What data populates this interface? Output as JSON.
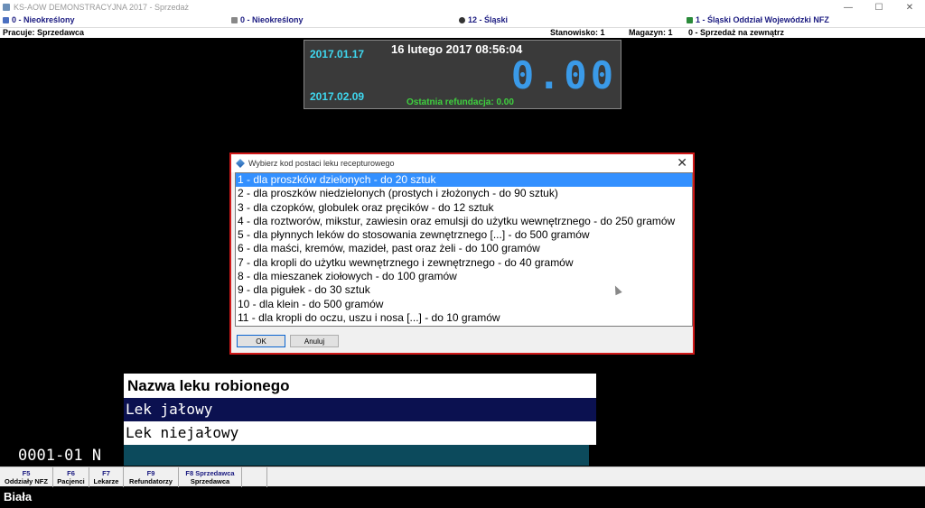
{
  "window": {
    "title": "KS-AOW DEMONSTRACYJNA 2017 - Sprzedaż",
    "minimize": "—",
    "maximize": "☐",
    "close": "✕"
  },
  "info_row1": {
    "c1": "0 - Nieokreślony",
    "c2": "0 - Nieokreślony",
    "c3": "12 - Śląski",
    "c4": "1 - Śląski Oddział Wojewódzki NFZ"
  },
  "info_row2": {
    "pracuje": "Pracuje: Sprzedawca",
    "stanowisko": "Stanowisko: 1",
    "magazyn": "Magazyn: 1",
    "sprzedaz": "0 - Sprzedaż na zewnątrz"
  },
  "display": {
    "date1": "2017.01.17",
    "date2": "2017.02.09",
    "datetime": "16 lutego 2017  08:56:04",
    "amount": "0.00",
    "refund": "Ostatnia refundacja: 0.00"
  },
  "dialog": {
    "title": "Wybierz kod postaci leku recepturowego",
    "close": "✕",
    "items": [
      "1 - dla proszków dzielonych - do 20 sztuk",
      "2 - dla proszków niedzielonych (prostych i złożonych - do 90 sztuk)",
      "3 - dla czopków, globulek oraz pręcików - do 12 sztuk",
      "4 - dla roztworów, mikstur, zawiesin oraz emulsji do użytku wewnętrznego - do 250 gramów",
      "5 - dla płynnych leków do stosowania zewnętrznego [...] - do 500 gramów",
      "6 - dla maści, kremów, mazideł, past oraz żeli - do 100 gramów",
      "7 - dla kropli do użytku wewnętrznego i zewnętrznego - do 40 gramów",
      "8 - dla mieszanek ziołowych - do 100 gramów",
      "9 - dla pigułek - do 30 sztuk",
      "10 - dla klein - do 500 gramów",
      "11 - dla kropli do oczu, uszu i nosa [...] - do 10 gramów"
    ],
    "ok": "OK",
    "cancel": "Anuluj"
  },
  "drug_panel": {
    "header": "Nazwa leku robionego",
    "option1": "Lek jałowy",
    "option2": "Lek niejałowy"
  },
  "status": {
    "code": "0001-01  N"
  },
  "fkeys": [
    {
      "key": "F5",
      "label": "Oddziały NFZ"
    },
    {
      "key": "F6",
      "label": "Pacjenci"
    },
    {
      "key": "F7",
      "label": "Lekarze"
    },
    {
      "key": "F9",
      "label": "Refundatorzy"
    },
    {
      "key": "F8 Sprzedawca",
      "label": "Sprzedawca"
    }
  ],
  "bottom": {
    "label": "Biała"
  },
  "colors": {
    "accent_cyan": "#3fd8f0",
    "amount_blue": "#3a9ae8",
    "refund_green": "#3ed13e",
    "selection": "#3390ff",
    "dialog_border": "#d01818"
  }
}
